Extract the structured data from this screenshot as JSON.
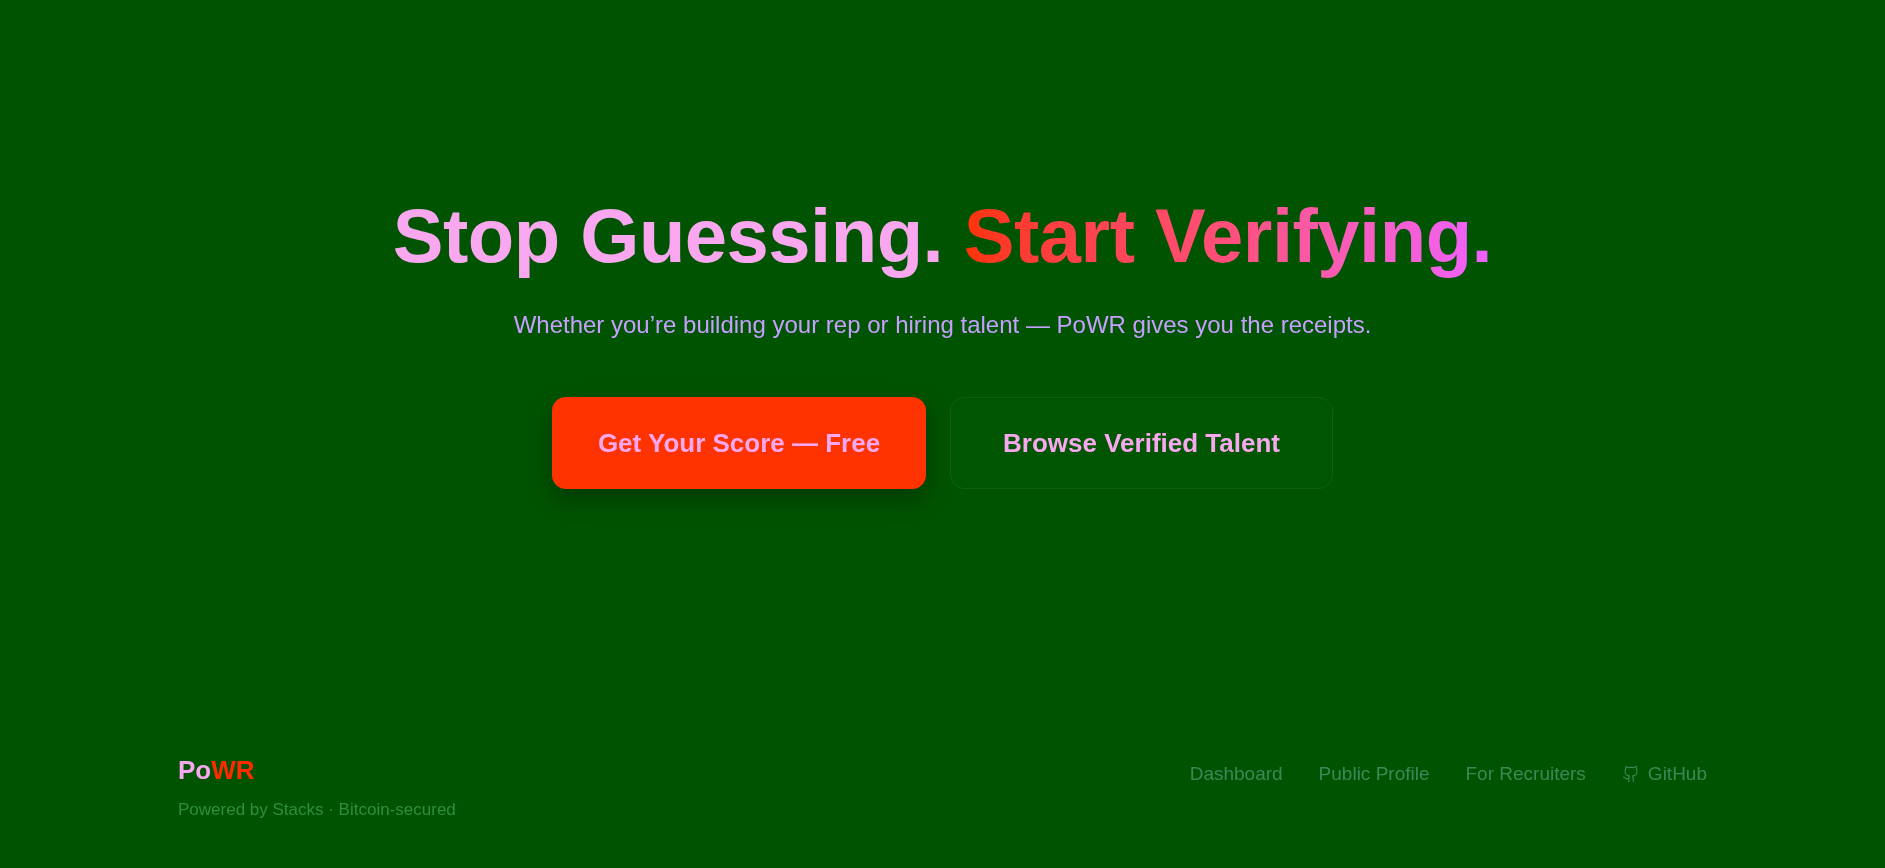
{
  "hero": {
    "headline_lead": "Stop Guessing.",
    "headline_accent": "Start Verifying.",
    "subtitle": "Whether you’re building your rep or hiring talent — PoWR gives you the receipts.",
    "buttons": [
      {
        "label": "Get Your Score — Free",
        "kind": "primary"
      },
      {
        "label": "Browse Verified Talent",
        "kind": "secondary"
      }
    ]
  },
  "footer": {
    "logo_lead": "Po",
    "logo_accent": "WR",
    "tagline": "Powered by Stacks · Bitcoin-secured",
    "links": [
      {
        "label": "Dashboard",
        "kind": "text"
      },
      {
        "label": "Public Profile",
        "kind": "text"
      },
      {
        "label": "For Recruiters",
        "kind": "text"
      },
      {
        "label": "GitHub",
        "kind": "icon"
      }
    ]
  }
}
